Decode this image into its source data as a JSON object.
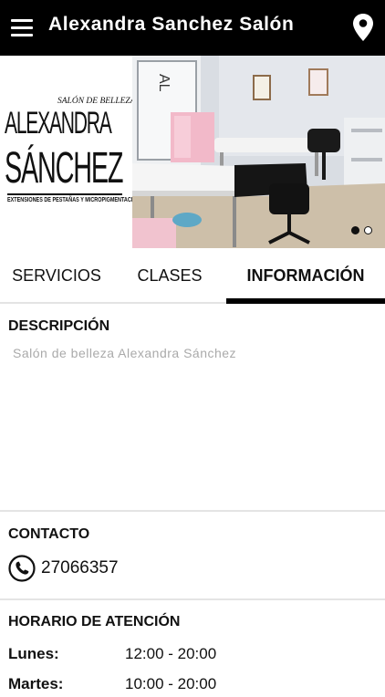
{
  "header": {
    "title": "Alexandra Sanchez Salón",
    "menu_icon": "hamburger-menu-icon",
    "location_icon": "map-pin-icon"
  },
  "banner": {
    "logo": {
      "top_text": "SALÓN DE BELLEZA",
      "line1": "ALEXANDRA",
      "line2": "SÁNCHEZ",
      "subtitle": "EXTENSIONES DE PESTAÑAS Y MICROPIGMENTACIÓN"
    },
    "slides_total": 2,
    "active_slide": 1
  },
  "tabs": [
    {
      "label": "SERVICIOS",
      "active": false
    },
    {
      "label": "CLASES",
      "active": false
    },
    {
      "label": "INFORMACIÓN",
      "active": true
    }
  ],
  "description": {
    "title": "DESCRIPCIÓN",
    "text": "Salón de belleza Alexandra Sánchez"
  },
  "contact": {
    "title": "CONTACTO",
    "phone": "27066357",
    "phone_icon": "phone-icon"
  },
  "hours": {
    "title": "HORARIO DE ATENCIÓN",
    "rows": [
      {
        "day": "Lunes:",
        "time": "12:00 - 20:00"
      },
      {
        "day": "Martes:",
        "time": "10:00 - 20:00"
      }
    ]
  },
  "colors": {
    "header_bg": "#000000",
    "accent": "#000000",
    "muted_text": "#aaaaaa",
    "divider": "#e4e4e4"
  }
}
